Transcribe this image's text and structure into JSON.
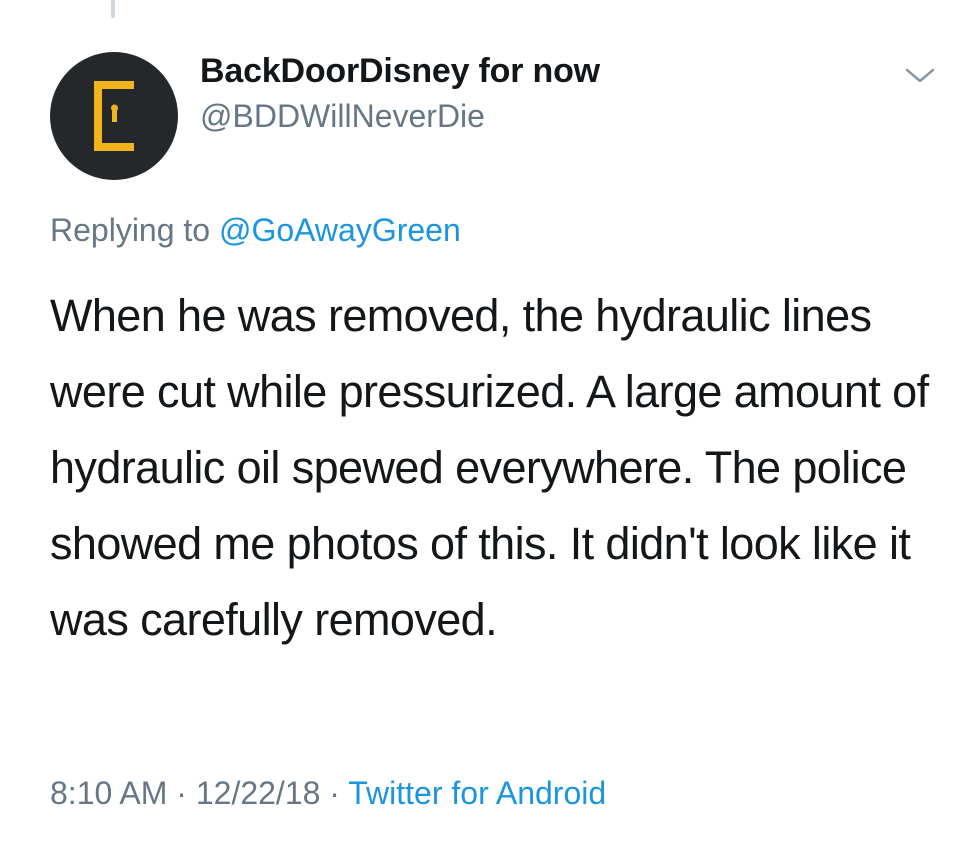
{
  "tweet": {
    "author_name": "BackDoorDisney for now",
    "author_handle": "@BDDWillNeverDie",
    "avatar_icon": "door-logo-icon",
    "menu_icon": "chevron-down-icon",
    "replying_to_label": "Replying to",
    "replying_to_handle": "@GoAwayGreen",
    "text": "When he was removed, the hydraulic lines were cut while pressurized. A large amount of hydraulic oil spewed everywhere. The police showed me photos of this. It didn't look like it was carefully removed.",
    "time": "8:10 AM",
    "separator": "·",
    "date": "12/22/18",
    "source": "Twitter for Android"
  },
  "colors": {
    "text_primary": "#14171a",
    "text_secondary": "#657786",
    "link": "#1b95e0",
    "avatar_bg": "#25282b",
    "logo": "#f2b41c"
  }
}
